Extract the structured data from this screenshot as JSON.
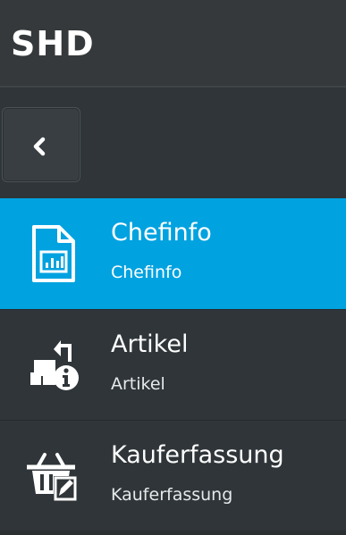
{
  "header": {
    "brand": "SHD"
  },
  "nav": {
    "items": [
      {
        "label": "Chefinfo",
        "sublabel": "Chefinfo",
        "icon": "report-chart-icon",
        "active": true
      },
      {
        "label": "Artikel",
        "sublabel": "Artikel",
        "icon": "article-info-icon",
        "active": false
      },
      {
        "label": "Kauferfassung",
        "sublabel": "Kauferfassung",
        "icon": "purchase-entry-icon",
        "active": false
      }
    ]
  },
  "colors": {
    "header_bg": "#35393b",
    "sidebar_bg": "#2f3538",
    "active_bg": "#00a2e0",
    "text": "#ffffff"
  },
  "toolbar": {
    "collapse_icon": "chevron-left-icon"
  }
}
